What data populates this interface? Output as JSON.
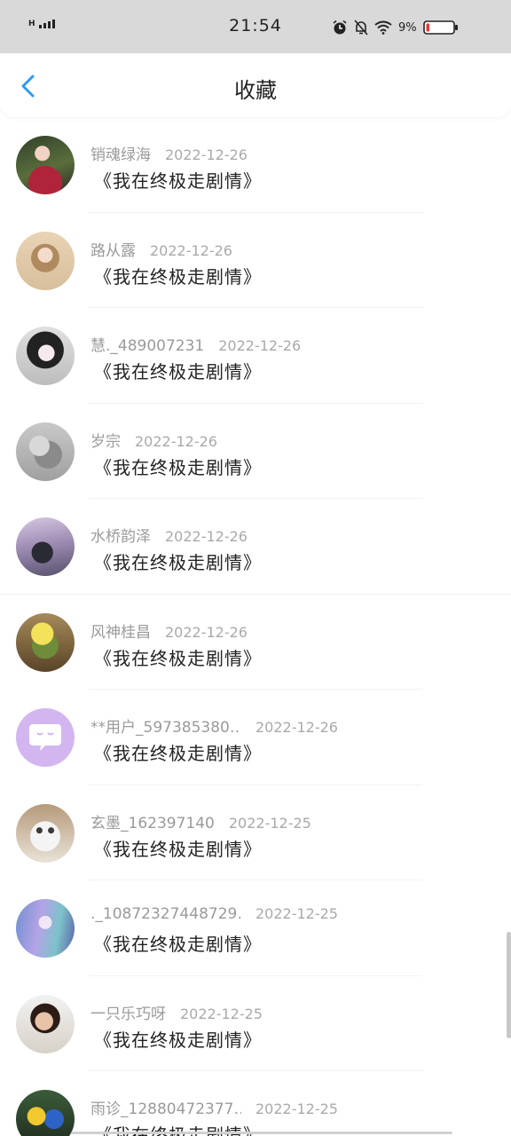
{
  "status_bar": {
    "network": "H",
    "time": "21:54",
    "battery_percent": "9%",
    "icons": [
      "alarm-icon",
      "mute-icon",
      "wifi-icon",
      "battery-icon"
    ]
  },
  "header": {
    "title": "收藏",
    "back_icon": "chevron-left-icon",
    "accent_color": "#2d9cf0"
  },
  "favorites": [
    {
      "user": "销魂绿海",
      "date": "2022-12-26",
      "book": "《我在终极走剧情》",
      "avatar": "avatar-1"
    },
    {
      "user": "路从露",
      "date": "2022-12-26",
      "book": "《我在终极走剧情》",
      "avatar": "avatar-2"
    },
    {
      "user": "慧._489007231",
      "date": "2022-12-26",
      "book": "《我在终极走剧情》",
      "avatar": "avatar-3"
    },
    {
      "user": "岁宗",
      "date": "2022-12-26",
      "book": "《我在终极走剧情》",
      "avatar": "avatar-4"
    },
    {
      "user": "水桥韵泽",
      "date": "2022-12-26",
      "book": "《我在终极走剧情》",
      "avatar": "avatar-5"
    },
    {
      "user": "风神桂昌",
      "date": "2022-12-26",
      "book": "《我在终极走剧情》",
      "avatar": "avatar-6"
    },
    {
      "user": "**用户_597385380…",
      "date": "2022-12-26",
      "book": "《我在终极走剧情》",
      "avatar": "avatar-7"
    },
    {
      "user": "玄墨_162397140",
      "date": "2022-12-25",
      "book": "《我在终极走剧情》",
      "avatar": "avatar-8"
    },
    {
      "user": "._10872327448729…",
      "date": "2022-12-25",
      "book": "《我在终极走剧情》",
      "avatar": "avatar-9"
    },
    {
      "user": "一只乐巧呀",
      "date": "2022-12-25",
      "book": "《我在终极走剧情》",
      "avatar": "avatar-10"
    },
    {
      "user": "雨诊_12880472377…",
      "date": "2022-12-25",
      "book": "《我在终极走剧情》",
      "avatar": "avatar-11"
    }
  ]
}
